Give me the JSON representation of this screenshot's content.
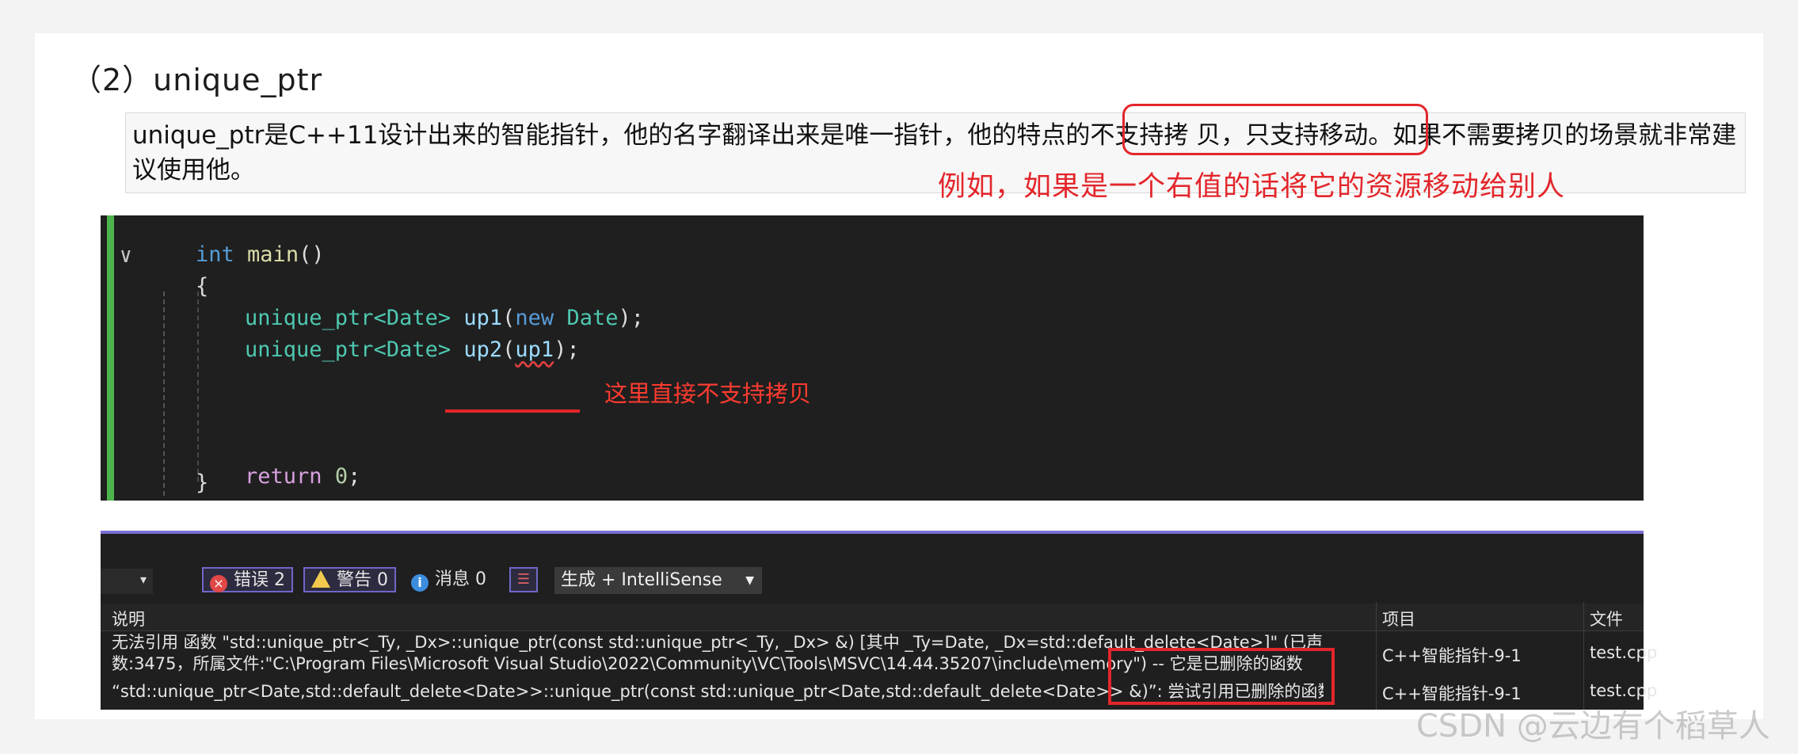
{
  "heading": "（2）unique_ptr",
  "quote": {
    "text": "unique_ptr是C++11设计出来的智能指针，他的名字翻译出来是唯一指针，他的特点的不支持拷 贝，只支持移动。如果不需要拷贝的场景就非常建议使用他。"
  },
  "annotation_note": "例如，如果是一个右值的话将它的资源移动给别人",
  "code": {
    "line1": {
      "kw": "int",
      "fn": "main",
      "rest": "()"
    },
    "line2": "{",
    "line3": {
      "type": "unique_ptr",
      "tmpl": "<Date>",
      "var": "up1",
      "p1": "(",
      "kw": "new",
      "ty2": "Date",
      "p2": ");"
    },
    "line4": {
      "type": "unique_ptr",
      "tmpl": "<Date>",
      "var": "up2",
      "p1": "(",
      "arg": "up1",
      "p2": ");"
    },
    "line5": {
      "kw": "return",
      "num": "0",
      "p": ";"
    },
    "line6": "}",
    "note": "这里直接不支持拷贝"
  },
  "error_list": {
    "errors_label": "错误 2",
    "warnings_label": "警告 0",
    "messages_label": "消息 0",
    "build_filter": "生成 + IntelliSense",
    "columns": {
      "desc": "说明",
      "project": "项目",
      "file": "文件"
    },
    "rows": [
      {
        "desc_line1": "无法引用 函数 \"std::unique_ptr<_Ty, _Dx>::unique_ptr(const std::unique_ptr<_Ty, _Dx> &) [其中 _Ty=Date, _Dx=std::default_delete<Date>]\" (已声明 所在行",
        "desc_line2": "数:3475，所属文件:\"C:\\Program Files\\Microsoft Visual Studio\\2022\\Community\\VC\\Tools\\MSVC\\14.44.35207\\include\\memory\") -- 它是已删除的函数",
        "project": "C++智能指针-9-1",
        "file": "test.cpp"
      },
      {
        "desc_line1": "“std::unique_ptr<Date,std::default_delete<Date>>::unique_ptr(const std::unique_ptr<Date,std::default_delete<Date>> &)”: 尝试引用已删除的函数",
        "project": "C++智能指针-9-1",
        "file": "test.cpp"
      }
    ]
  },
  "watermark": "CSDN @云边有个稻草人",
  "colors": {
    "annotation_red": "#e3262b",
    "gutter_green": "#4db34d",
    "panel_divider_purple": "#7a6fd6"
  }
}
